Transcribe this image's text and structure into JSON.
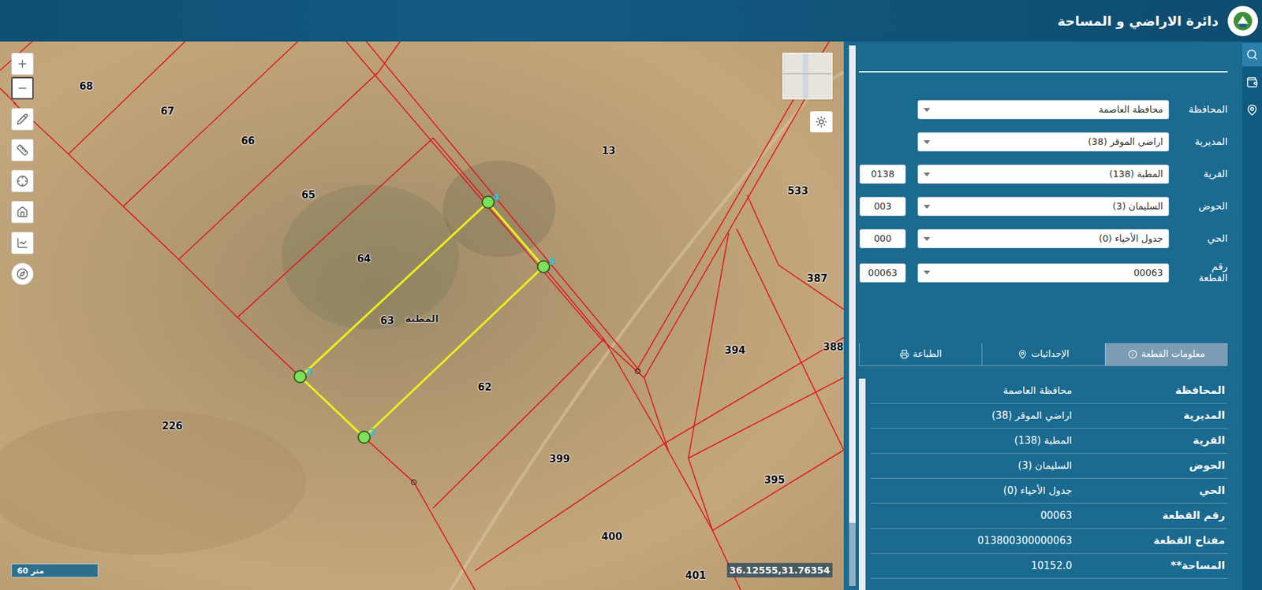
{
  "header": {
    "title": "دائرة الاراضي و المساحة"
  },
  "map": {
    "parcels": [
      {
        "label": "68"
      },
      {
        "label": "67"
      },
      {
        "label": "66"
      },
      {
        "label": "65"
      },
      {
        "label": "64"
      },
      {
        "label": "63"
      },
      {
        "label": "62"
      },
      {
        "label": "13"
      },
      {
        "label": "533"
      },
      {
        "label": "387"
      },
      {
        "label": "394"
      },
      {
        "label": "388"
      },
      {
        "label": "226"
      },
      {
        "label": "399"
      },
      {
        "label": "395"
      },
      {
        "label": "400"
      },
      {
        "label": "401"
      }
    ],
    "place_name": "المطبة",
    "vertices": [
      {
        "label": "4"
      },
      {
        "label": "5"
      },
      {
        "label": "2"
      },
      {
        "label": "3"
      }
    ],
    "scale": "60 متر",
    "coordinates": "36.12555,31.76354",
    "tools": [
      {
        "kind": "zoom-in",
        "selected": false
      },
      {
        "kind": "zoom-out",
        "selected": true
      },
      {
        "kind": "draw",
        "selected": false
      },
      {
        "kind": "measure",
        "selected": false
      },
      {
        "kind": "locate",
        "selected": false
      },
      {
        "kind": "home",
        "selected": false
      },
      {
        "kind": "profile",
        "selected": false
      },
      {
        "kind": "north",
        "selected": false
      }
    ]
  },
  "side_tools": [
    {
      "kind": "search",
      "selected": true
    },
    {
      "kind": "wallet",
      "selected": false
    },
    {
      "kind": "location",
      "selected": false
    }
  ],
  "form": [
    {
      "label": "المحافظة",
      "value": "محافظة العاصمة"
    },
    {
      "label": "المديرية",
      "value": "اراضي الموقر (38)"
    },
    {
      "label": "القرية",
      "value": "المطبة (138)",
      "code": "0138"
    },
    {
      "label": "الحوض",
      "value": "السليمان (3)",
      "code": "003"
    },
    {
      "label": "الحي",
      "value": "جدول الأحياء (0)",
      "code": "000"
    },
    {
      "label": "رقم القطعة",
      "value": "00063",
      "code": "00063"
    }
  ],
  "tabs": [
    {
      "label": "معلومات القطعة",
      "kind": "info",
      "selected": true
    },
    {
      "label": "الإحداثيات",
      "kind": "coordinates",
      "selected": false
    },
    {
      "label": "الطباعة",
      "kind": "print",
      "selected": false
    }
  ],
  "info": [
    {
      "label": "المحافظة",
      "value": "محافظة العاصمة"
    },
    {
      "label": "المديرية",
      "value": "اراضي الموقر (38)"
    },
    {
      "label": "القرية",
      "value": "المطبة (138)"
    },
    {
      "label": "الحوض",
      "value": "السليمان (3)"
    },
    {
      "label": "الحي",
      "value": "جدول الأحياء (0)"
    },
    {
      "label": "رقم القطعة",
      "value": "00063"
    },
    {
      "label": "مفتاح القطعة",
      "value": "013800300000063"
    },
    {
      "label": "المساحة**",
      "value": "10152.0"
    }
  ]
}
